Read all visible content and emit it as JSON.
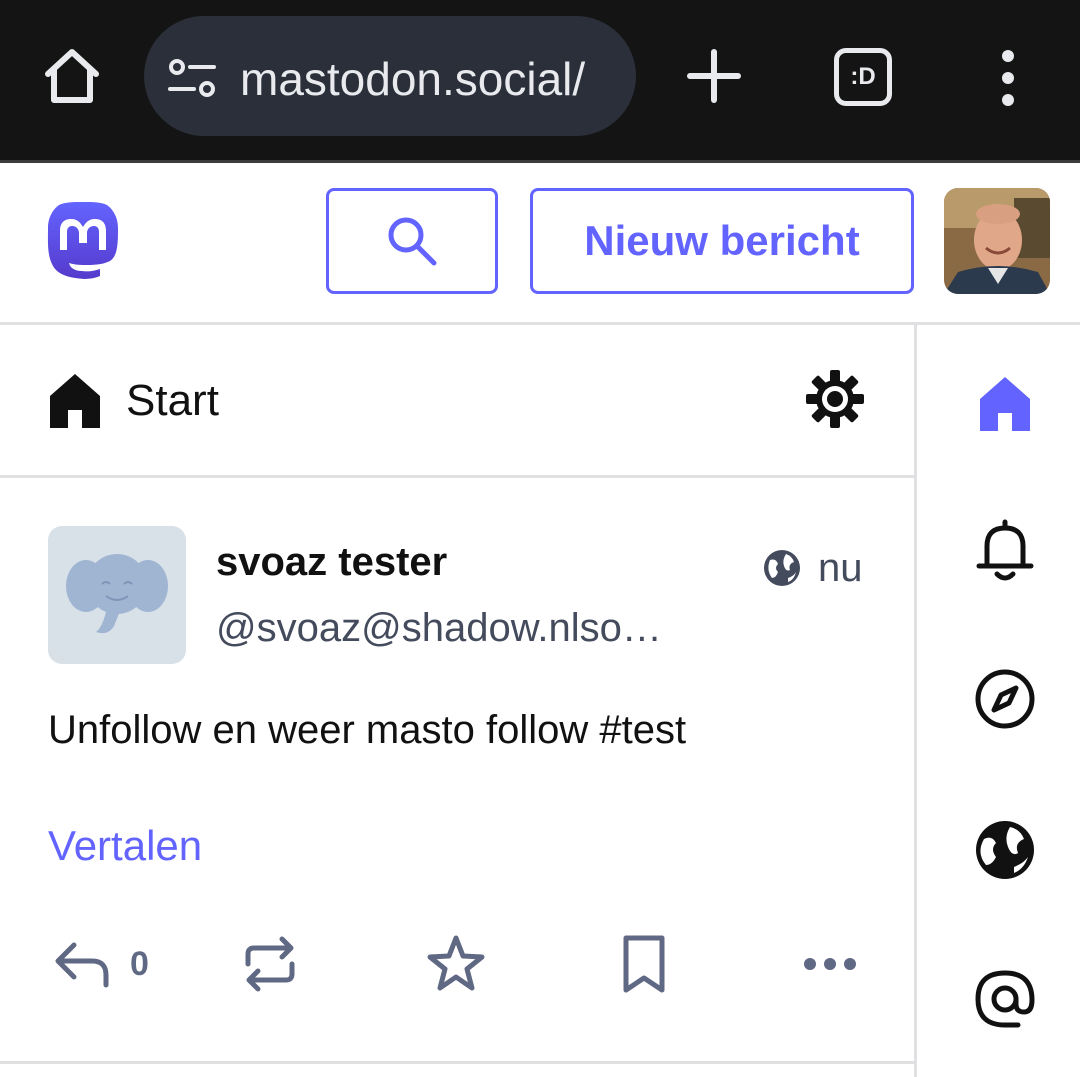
{
  "browser": {
    "url": "mastodon.social/",
    "tabs_label": ":D"
  },
  "header": {
    "compose_label": "Nieuw bericht"
  },
  "column": {
    "title": "Start"
  },
  "status": {
    "display_name": "svoaz tester",
    "acct": "@svoaz@shadow.nlso…",
    "timestamp": "nu",
    "content": "Unfollow en weer masto follow #test",
    "translate_label": "Vertalen",
    "reply_count": "0"
  },
  "nav": {
    "items": [
      "home-icon",
      "bell-icon",
      "compass-icon",
      "globe-icon",
      "at-icon"
    ],
    "active": "home-icon"
  },
  "colors": {
    "accent": "#6364ff",
    "icon_gray": "#606984",
    "text": "#111111",
    "browser_bg": "#141414"
  }
}
